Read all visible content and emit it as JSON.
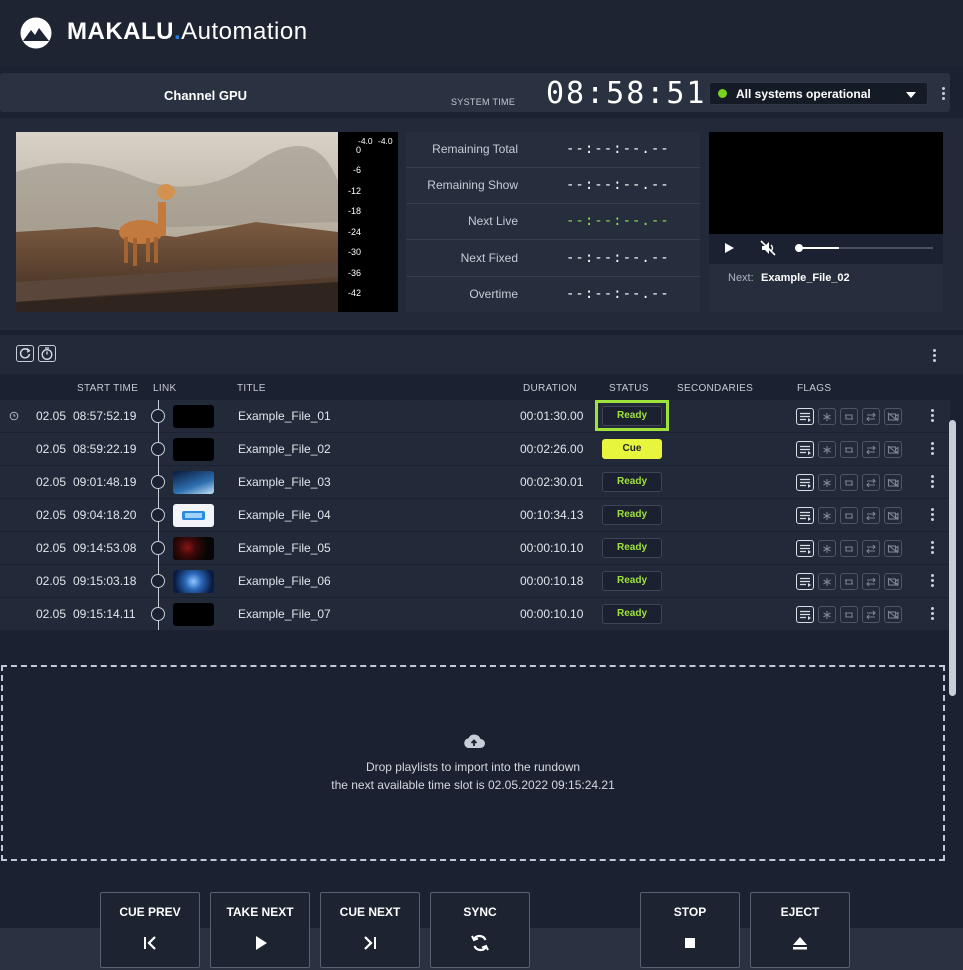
{
  "brand": {
    "name": "MAKALU",
    "dot": ".",
    "suffix": "Automation"
  },
  "channel": {
    "title": "Channel GPU",
    "system_time_label": "SYSTEM TIME",
    "clock": "08:58:51",
    "system_status": "All systems operational",
    "status_color": "#7ad11f"
  },
  "audio_meter": {
    "top_labels": [
      "-4.0",
      "-4.0"
    ],
    "scale": [
      "0",
      "-6",
      "-12",
      "-18",
      "-24",
      "-30",
      "-36",
      "-42"
    ]
  },
  "timers": [
    {
      "label": "Remaining Total",
      "value": "--:--:--.--"
    },
    {
      "label": "Remaining Show",
      "value": "--:--:--.--"
    },
    {
      "label": "Next Live",
      "value": "--:--:--.--"
    },
    {
      "label": "Next Fixed",
      "value": "--:--:--.--"
    },
    {
      "label": "Overtime",
      "value": "--:--:--.--"
    }
  ],
  "next_player": {
    "label": "Next:",
    "file": "Example_File_02",
    "progress": 0.3
  },
  "table": {
    "headers": {
      "start_time": "START TIME",
      "link": "LINK",
      "title": "TITLE",
      "duration": "DURATION",
      "status": "STATUS",
      "secondaries": "SECONDARIES",
      "flags": "FLAGS"
    },
    "rows": [
      {
        "start_date": "02.05",
        "start_time": "08:57:52.19",
        "title": "Example_File_01",
        "duration": "00:01:30.00",
        "status": "Ready"
      },
      {
        "start_date": "02.05",
        "start_time": "08:59:22.19",
        "title": "Example_File_02",
        "duration": "00:02:26.00",
        "status": "Cue"
      },
      {
        "start_date": "02.05",
        "start_time": "09:01:48.19",
        "title": "Example_File_03",
        "duration": "00:02:30.01",
        "status": "Ready"
      },
      {
        "start_date": "02.05",
        "start_time": "09:04:18.20",
        "title": "Example_File_04",
        "duration": "00:10:34.13",
        "status": "Ready"
      },
      {
        "start_date": "02.05",
        "start_time": "09:14:53.08",
        "title": "Example_File_05",
        "duration": "00:00:10.10",
        "status": "Ready"
      },
      {
        "start_date": "02.05",
        "start_time": "09:15:03.18",
        "title": "Example_File_06",
        "duration": "00:00:10.18",
        "status": "Ready"
      },
      {
        "start_date": "02.05",
        "start_time": "09:15:14.11",
        "title": "Example_File_07",
        "duration": "00:00:10.10",
        "status": "Ready"
      }
    ]
  },
  "dropzone": {
    "line1": "Drop playlists to import into the rundown",
    "line2": "the next available time slot is 02.05.2022 09:15:24.21"
  },
  "controls": {
    "cue_prev": "CUE PREV",
    "take_next": "TAKE NEXT",
    "cue_next": "CUE NEXT",
    "sync": "SYNC",
    "stop": "STOP",
    "eject": "EJECT"
  },
  "colors": {
    "accent_blue": "#1e7fe0",
    "ready_green": "#9fe23c",
    "cue_yellow": "#e7f53c",
    "background": "#1b2130"
  }
}
